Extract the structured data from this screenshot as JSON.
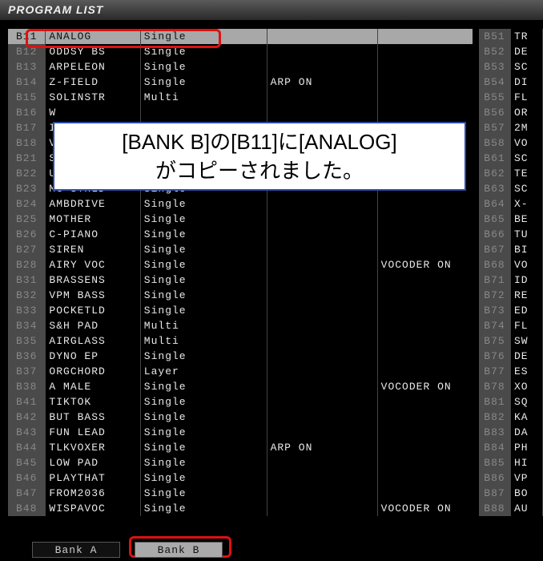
{
  "title": "PROGRAM LIST",
  "bank_tabs": {
    "a": "Bank A",
    "b": "Bank B",
    "active": "b"
  },
  "overlay": {
    "line1": "[BANK B]の[B11]に[ANALOG]",
    "line2": "がコピーされました。"
  },
  "rows": [
    {
      "id": "B11",
      "name": "ANALOG",
      "mode": "Single",
      "flag1": "",
      "flag2": "",
      "sel": true
    },
    {
      "id": "B12",
      "name": "ODDSY BS",
      "mode": "Single",
      "flag1": "",
      "flag2": ""
    },
    {
      "id": "B13",
      "name": "ARPELEON",
      "mode": "Single",
      "flag1": "",
      "flag2": ""
    },
    {
      "id": "B14",
      "name": "Z-FIELD",
      "mode": "Single",
      "flag1": "ARP ON",
      "flag2": ""
    },
    {
      "id": "B15",
      "name": "SOLINSTR",
      "mode": "Multi",
      "flag1": "",
      "flag2": ""
    },
    {
      "id": "B16",
      "name": "W",
      "mode": "",
      "flag1": "",
      "flag2": ""
    },
    {
      "id": "B17",
      "name": "I",
      "mode": "",
      "flag1": "",
      "flag2": ""
    },
    {
      "id": "B18",
      "name": "V",
      "mode": "",
      "flag1": "",
      "flag2": ""
    },
    {
      "id": "B21",
      "name": "S",
      "mode": "",
      "flag1": "",
      "flag2": ""
    },
    {
      "id": "B22",
      "name": "U",
      "mode": "",
      "flag1": "",
      "flag2": ""
    },
    {
      "id": "B23",
      "name": "MG STHLD",
      "mode": "Single",
      "flag1": "",
      "flag2": ""
    },
    {
      "id": "B24",
      "name": "AMBDRIVE",
      "mode": "Single",
      "flag1": "",
      "flag2": ""
    },
    {
      "id": "B25",
      "name": "MOTHER",
      "mode": "Single",
      "flag1": "",
      "flag2": ""
    },
    {
      "id": "B26",
      "name": "C-PIANO",
      "mode": "Single",
      "flag1": "",
      "flag2": ""
    },
    {
      "id": "B27",
      "name": "SIREN",
      "mode": "Single",
      "flag1": "",
      "flag2": ""
    },
    {
      "id": "B28",
      "name": "AIRY VOC",
      "mode": "Single",
      "flag1": "",
      "flag2": "VOCODER ON"
    },
    {
      "id": "B31",
      "name": "BRASSENS",
      "mode": "Single",
      "flag1": "",
      "flag2": ""
    },
    {
      "id": "B32",
      "name": "VPM BASS",
      "mode": "Single",
      "flag1": "",
      "flag2": ""
    },
    {
      "id": "B33",
      "name": "POCKETLD",
      "mode": "Single",
      "flag1": "",
      "flag2": ""
    },
    {
      "id": "B34",
      "name": "S&H PAD",
      "mode": "Multi",
      "flag1": "",
      "flag2": ""
    },
    {
      "id": "B35",
      "name": "AIRGLASS",
      "mode": "Multi",
      "flag1": "",
      "flag2": ""
    },
    {
      "id": "B36",
      "name": "DYNO EP",
      "mode": "Single",
      "flag1": "",
      "flag2": ""
    },
    {
      "id": "B37",
      "name": "ORGCHORD",
      "mode": "Layer",
      "flag1": "",
      "flag2": ""
    },
    {
      "id": "B38",
      "name": "A MALE",
      "mode": "Single",
      "flag1": "",
      "flag2": "VOCODER ON"
    },
    {
      "id": "B41",
      "name": "TIKTOK",
      "mode": "Single",
      "flag1": "",
      "flag2": ""
    },
    {
      "id": "B42",
      "name": "BUT BASS",
      "mode": "Single",
      "flag1": "",
      "flag2": ""
    },
    {
      "id": "B43",
      "name": "FUN LEAD",
      "mode": "Single",
      "flag1": "",
      "flag2": ""
    },
    {
      "id": "B44",
      "name": "TLKVOXER",
      "mode": "Single",
      "flag1": "ARP ON",
      "flag2": ""
    },
    {
      "id": "B45",
      "name": "LOW PAD",
      "mode": "Single",
      "flag1": "",
      "flag2": ""
    },
    {
      "id": "B46",
      "name": "PLAYTHAT",
      "mode": "Single",
      "flag1": "",
      "flag2": ""
    },
    {
      "id": "B47",
      "name": "FROM2036",
      "mode": "Single",
      "flag1": "",
      "flag2": ""
    },
    {
      "id": "B48",
      "name": "WISPAVOC",
      "mode": "Single",
      "flag1": "",
      "flag2": "VOCODER ON"
    }
  ],
  "right_rows": [
    {
      "id": "B51",
      "name": "TR"
    },
    {
      "id": "B52",
      "name": "DE"
    },
    {
      "id": "B53",
      "name": "SC"
    },
    {
      "id": "B54",
      "name": "DI"
    },
    {
      "id": "B55",
      "name": "FL"
    },
    {
      "id": "B56",
      "name": "OR"
    },
    {
      "id": "B57",
      "name": "2M"
    },
    {
      "id": "B58",
      "name": "VO"
    },
    {
      "id": "B61",
      "name": "SC"
    },
    {
      "id": "B62",
      "name": "TE"
    },
    {
      "id": "B63",
      "name": "SC"
    },
    {
      "id": "B64",
      "name": "X-"
    },
    {
      "id": "B65",
      "name": "BE"
    },
    {
      "id": "B66",
      "name": "TU"
    },
    {
      "id": "B67",
      "name": "BI"
    },
    {
      "id": "B68",
      "name": "VO"
    },
    {
      "id": "B71",
      "name": "ID"
    },
    {
      "id": "B72",
      "name": "RE"
    },
    {
      "id": "B73",
      "name": "ED"
    },
    {
      "id": "B74",
      "name": "FL"
    },
    {
      "id": "B75",
      "name": "SW"
    },
    {
      "id": "B76",
      "name": "DE"
    },
    {
      "id": "B77",
      "name": "ES"
    },
    {
      "id": "B78",
      "name": "XO"
    },
    {
      "id": "B81",
      "name": "SQ"
    },
    {
      "id": "B82",
      "name": "KA"
    },
    {
      "id": "B83",
      "name": "DA"
    },
    {
      "id": "B84",
      "name": "PH"
    },
    {
      "id": "B85",
      "name": "HI"
    },
    {
      "id": "B86",
      "name": "VP"
    },
    {
      "id": "B87",
      "name": "BO"
    },
    {
      "id": "B88",
      "name": "AU"
    }
  ]
}
